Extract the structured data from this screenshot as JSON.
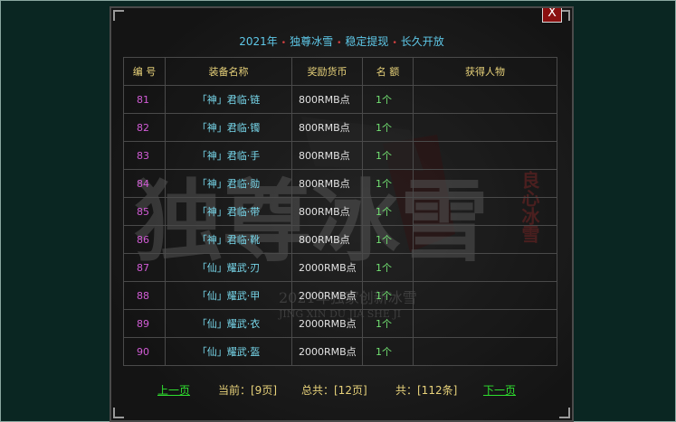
{
  "title": {
    "year": "2021年",
    "name": "独尊冰雪",
    "slogan1": "稳定提现",
    "slogan2": "长久开放",
    "separator": "•"
  },
  "close_label": "X",
  "headers": {
    "no": "编 号",
    "item_name": "装备名称",
    "reward": "奖励货币",
    "quota": "名 额",
    "winner": "获得人物"
  },
  "rows": [
    {
      "no": "81",
      "item_name": "「神」君临·链",
      "reward": "800RMB点",
      "quota": "1个",
      "winner": ""
    },
    {
      "no": "82",
      "item_name": "「神」君临·镯",
      "reward": "800RMB点",
      "quota": "1个",
      "winner": ""
    },
    {
      "no": "83",
      "item_name": "「神」君临·手",
      "reward": "800RMB点",
      "quota": "1个",
      "winner": ""
    },
    {
      "no": "84",
      "item_name": "「神」君临·勋",
      "reward": "800RMB点",
      "quota": "1个",
      "winner": ""
    },
    {
      "no": "85",
      "item_name": "「神」君临·带",
      "reward": "800RMB点",
      "quota": "1个",
      "winner": ""
    },
    {
      "no": "86",
      "item_name": "「神」君临·靴",
      "reward": "800RMB点",
      "quota": "1个",
      "winner": ""
    },
    {
      "no": "87",
      "item_name": "「仙」耀武·刃",
      "reward": "2000RMB点",
      "quota": "1个",
      "winner": ""
    },
    {
      "no": "88",
      "item_name": "「仙」耀武·甲",
      "reward": "2000RMB点",
      "quota": "1个",
      "winner": ""
    },
    {
      "no": "89",
      "item_name": "「仙」耀武·衣",
      "reward": "2000RMB点",
      "quota": "1个",
      "winner": ""
    },
    {
      "no": "90",
      "item_name": "「仙」耀武·盔",
      "reward": "2000RMB点",
      "quota": "1个",
      "winner": ""
    }
  ],
  "footer": {
    "prev": "上一页",
    "current": "当前：[9页]",
    "total_pages": "总共：[12页]",
    "total_items": "共：[112条]",
    "next": "下一页"
  },
  "watermark": {
    "big_text": "独尊冰雪",
    "side_text": "良心冰雪",
    "slogan": "2021年独家创新冰雪",
    "pinyin": "JING XIN DU JIA SHE JI"
  },
  "colors": {
    "title": "#5ec8e8",
    "header": "#e8d27a",
    "number": "#d25cd6",
    "item_name": "#78d8ec",
    "quota": "#72e272",
    "link": "#2fe02f"
  }
}
